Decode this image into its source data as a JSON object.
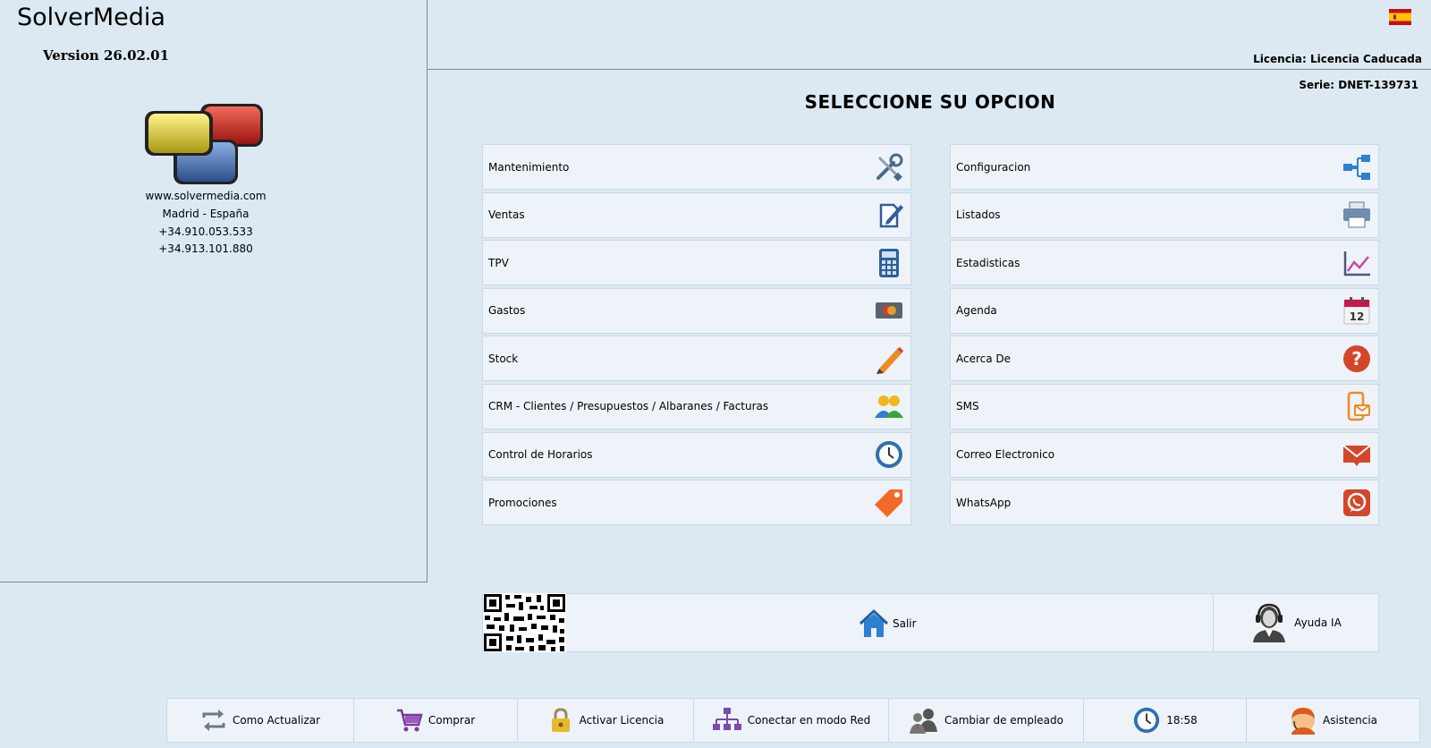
{
  "app": {
    "title": "SolverMedia",
    "version": "Version 26.02.01",
    "license": "Licencia: Licencia Caducada",
    "serial": "Serie: DNET-139731",
    "language_flag": "spain-flag-icon"
  },
  "contact": {
    "website": "www.solvermedia.com",
    "location": "Madrid - España",
    "phone1": "+34.910.053.533",
    "phone2": "+34.913.101.880"
  },
  "main": {
    "heading": "SELECCIONE SU OPCION",
    "left_menu": [
      {
        "label": "Mantenimiento",
        "icon": "tools-icon"
      },
      {
        "label": "Ventas",
        "icon": "document-edit-icon"
      },
      {
        "label": "TPV",
        "icon": "calculator-icon"
      },
      {
        "label": "Gastos",
        "icon": "credit-card-icon"
      },
      {
        "label": "Stock",
        "icon": "pencil-icon"
      },
      {
        "label": "CRM - Clientes / Presupuestos / Albaranes / Facturas",
        "icon": "users-icon"
      },
      {
        "label": "Control de Horarios",
        "icon": "clock-icon"
      },
      {
        "label": "Promociones",
        "icon": "tag-icon"
      }
    ],
    "right_menu": [
      {
        "label": "Configuracion",
        "icon": "network-icon"
      },
      {
        "label": "Listados",
        "icon": "printer-icon"
      },
      {
        "label": "Estadisticas",
        "icon": "line-chart-icon"
      },
      {
        "label": "Agenda",
        "icon": "calendar-icon"
      },
      {
        "label": "Acerca De",
        "icon": "help-icon"
      },
      {
        "label": "SMS",
        "icon": "mobile-message-icon"
      },
      {
        "label": "Correo Electronico",
        "icon": "mail-icon"
      },
      {
        "label": "WhatsApp",
        "icon": "whatsapp-icon"
      }
    ]
  },
  "actions": {
    "exit_label": "Salir",
    "ai_help_label": "Ayuda IA"
  },
  "footer": [
    {
      "label": "Como Actualizar",
      "icon": "refresh-icon"
    },
    {
      "label": "Comprar",
      "icon": "cart-icon"
    },
    {
      "label": "Activar Licencia",
      "icon": "lock-icon"
    },
    {
      "label": "Conectar en modo Red",
      "icon": "network-tree-icon"
    },
    {
      "label": "Cambiar de empleado",
      "icon": "employees-icon"
    },
    {
      "label": "18:58",
      "icon": "clock-icon"
    },
    {
      "label": "Asistencia",
      "icon": "support-agent-icon"
    }
  ],
  "colors": {
    "background": "#dde9f2",
    "tile": "#edf3f8",
    "border": "#6f8ea8"
  }
}
